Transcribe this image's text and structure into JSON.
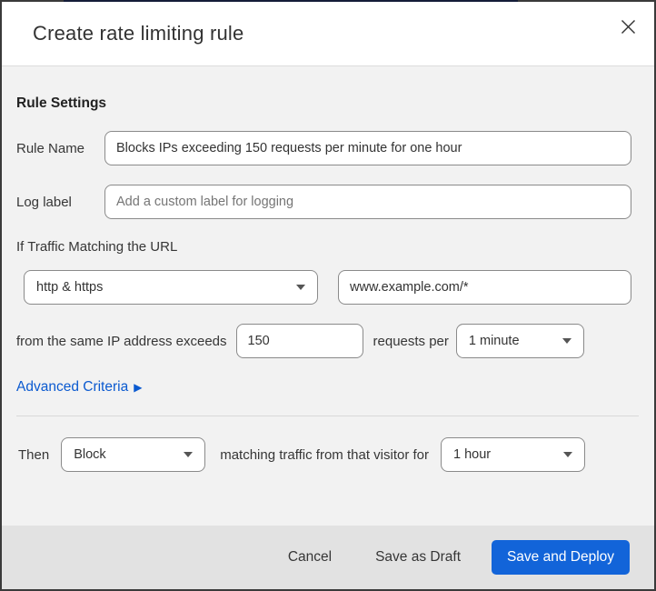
{
  "dialog": {
    "title": "Create rate limiting rule"
  },
  "section": {
    "heading": "Rule Settings"
  },
  "fields": {
    "rule_name": {
      "label": "Rule Name",
      "value": "Blocks IPs exceeding 150 requests per minute for one hour"
    },
    "log_label": {
      "label": "Log label",
      "placeholder": "Add a custom label for logging"
    },
    "traffic_match": {
      "label": "If Traffic Matching the URL",
      "scheme_selected": "http & https",
      "url_value": "www.example.com/*"
    },
    "threshold": {
      "prefix": "from the same IP address exceeds",
      "requests_value": "150",
      "middle": "requests per",
      "period_selected": "1 minute"
    },
    "advanced": {
      "label": "Advanced Criteria"
    },
    "action": {
      "prefix": "Then",
      "action_selected": "Block",
      "middle": "matching traffic from that visitor for",
      "duration_selected": "1 hour"
    }
  },
  "footer": {
    "cancel_label": "Cancel",
    "save_draft_label": "Save as Draft",
    "save_deploy_label": "Save and Deploy"
  },
  "colors": {
    "primary_button": "#1264d9",
    "link_blue": "#0b5ad0",
    "body_background": "#f2f2f2",
    "footer_background": "#e2e2e2",
    "border": "#3a3a3a"
  }
}
